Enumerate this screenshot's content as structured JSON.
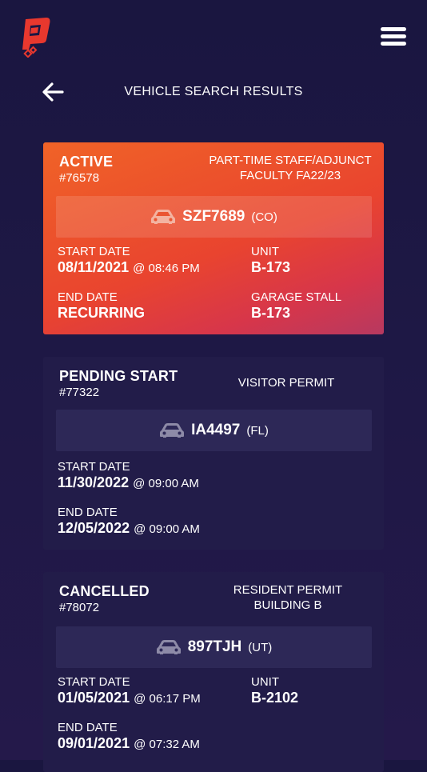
{
  "header": {
    "title": "VEHICLE SEARCH RESULTS",
    "logo_icon": "parking-logo-icon",
    "menu_icon": "hamburger-menu-icon",
    "back_icon": "back-arrow-icon"
  },
  "colors": {
    "background": "#1c1743",
    "active_card_start": "#f06327",
    "active_card_end": "#c23a58",
    "dark_card": "#221c49",
    "plate_box_dark": "#2d2857",
    "logo": "#e8382e"
  },
  "permits": [
    {
      "status": "ACTIVE",
      "number": "#76578",
      "type": "PART-TIME STAFF/ADJUNCT FACULTY FA22/23",
      "plate": "SZF7689",
      "state": "(CO)",
      "start_label": "START DATE",
      "start_date": "08/11/2021",
      "start_time": "@ 08:46 PM",
      "end_label": "END DATE",
      "end_date": "RECURRING",
      "unit_label": "UNIT",
      "unit": "B-173",
      "stall_label": "GARAGE STALL",
      "stall": "B-173"
    },
    {
      "status": "PENDING START",
      "number": "#77322",
      "type": "VISITOR PERMIT",
      "plate": "IA4497",
      "state": "(FL)",
      "start_label": "START DATE",
      "start_date": "11/30/2022",
      "start_time": "@ 09:00 AM",
      "end_label": "END DATE",
      "end_date": "12/05/2022",
      "end_time": "@ 09:00 AM"
    },
    {
      "status": "CANCELLED",
      "number": "#78072",
      "type": "RESIDENT PERMIT BUILDING B",
      "plate": "897TJH",
      "state": "(UT)",
      "start_label": "START DATE",
      "start_date": "01/05/2021",
      "start_time": "@ 06:17 PM",
      "end_label": "END DATE",
      "end_date": "09/01/2021",
      "end_time": "@ 07:32 AM",
      "unit_label": "UNIT",
      "unit": "B-2102"
    }
  ]
}
